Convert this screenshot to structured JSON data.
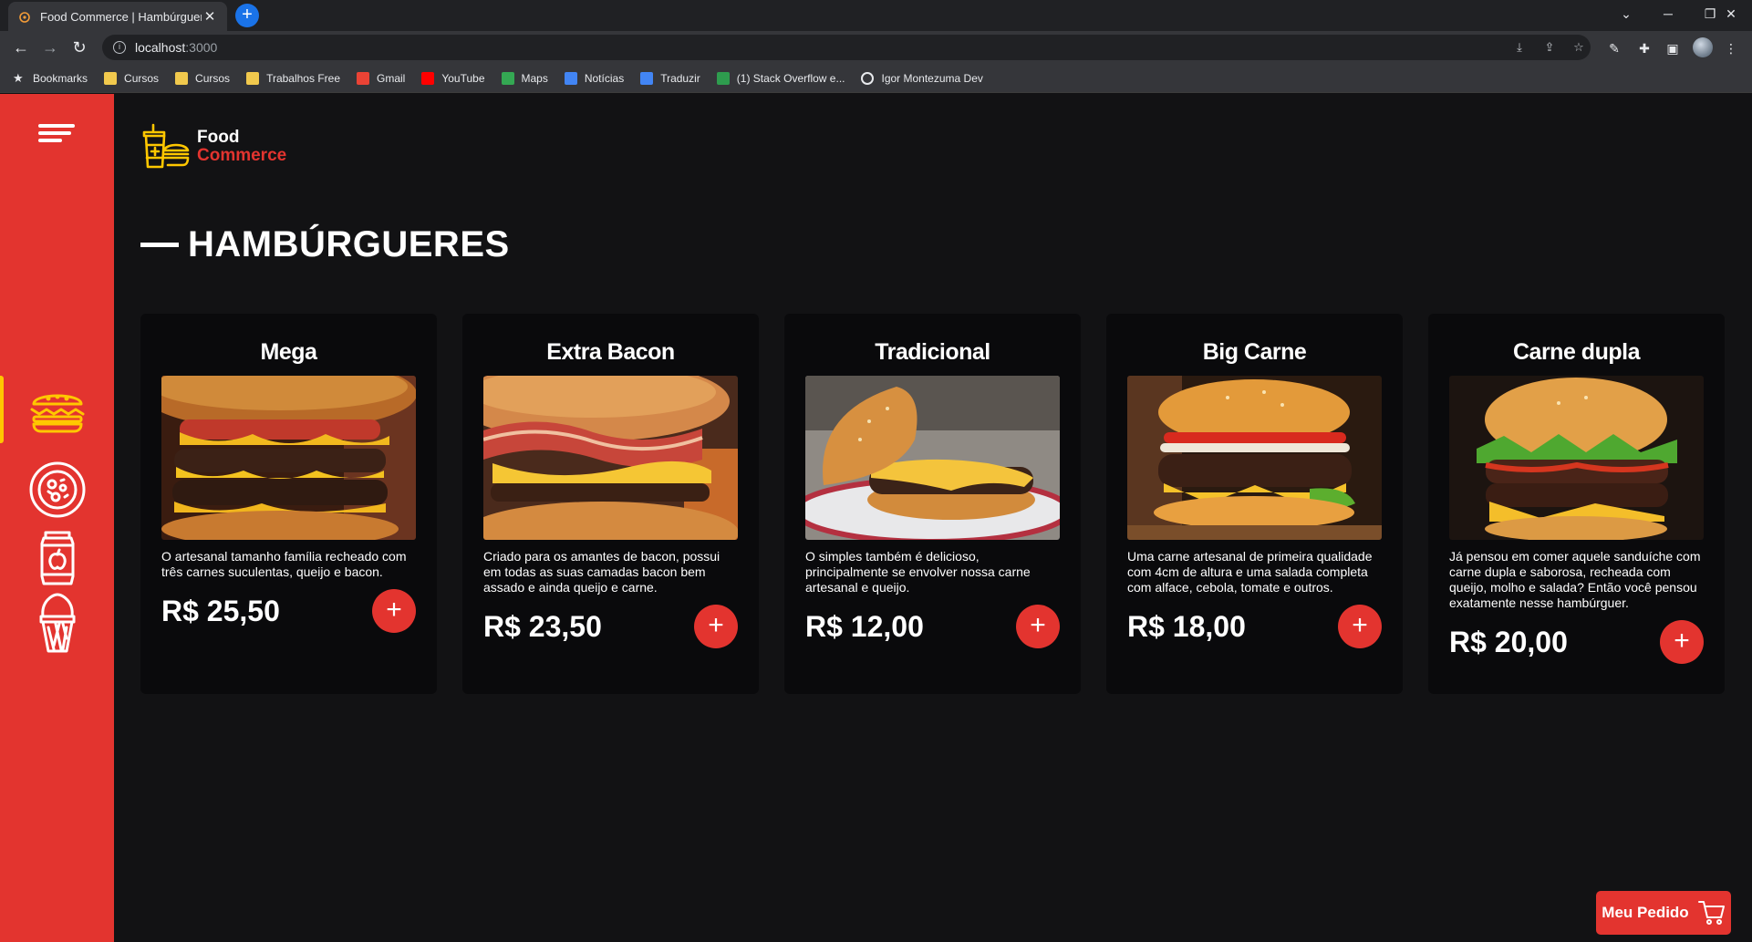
{
  "browser": {
    "tab_title": "Food Commerce | Hambúrgueres",
    "url_host": "localhost",
    "url_port": ":3000",
    "bookmarks": [
      {
        "label": "Bookmarks",
        "icon": "star-icon",
        "color": "#e8eaed"
      },
      {
        "label": "Cursos",
        "icon": "folder-icon",
        "color": "#f1c94d"
      },
      {
        "label": "Cursos",
        "icon": "folder-icon",
        "color": "#f1c94d"
      },
      {
        "label": "Trabalhos Free",
        "icon": "folder-icon",
        "color": "#f1c94d"
      },
      {
        "label": "Gmail",
        "icon": "gmail-icon",
        "color": "#ea4335"
      },
      {
        "label": "YouTube",
        "icon": "youtube-icon",
        "color": "#ff0000"
      },
      {
        "label": "Maps",
        "icon": "maps-icon",
        "color": "#34a853"
      },
      {
        "label": "Notícias",
        "icon": "news-icon",
        "color": "#4285f4"
      },
      {
        "label": "Traduzir",
        "icon": "translate-icon",
        "color": "#4285f4"
      },
      {
        "label": "(1) Stack Overflow e...",
        "icon": "stackoverflow-icon",
        "color": "#2e9c4e"
      },
      {
        "label": "Igor Montezuma Dev",
        "icon": "globe-icon",
        "color": "#e8eaed"
      }
    ]
  },
  "app": {
    "logo": {
      "line1": "Food",
      "line2": "Commerce"
    },
    "section_title": "HAMBÚRGUERES",
    "products": [
      {
        "name": "Mega",
        "description": "O artesanal tamanho família recheado com três carnes suculentas, queijo e bacon.",
        "price": "R$ 25,50"
      },
      {
        "name": "Extra Bacon",
        "description": "Criado para os amantes de bacon, possui em todas as suas camadas bacon bem assado e ainda queijo e carne.",
        "price": "R$ 23,50"
      },
      {
        "name": "Tradicional",
        "description": "O simples também é delicioso, principalmente se envolver nossa carne artesanal e queijo.",
        "price": "R$ 12,00"
      },
      {
        "name": "Big Carne",
        "description": "Uma carne artesanal de primeira qualidade com 4cm de altura e uma salada completa com alface, cebola, tomate e outros.",
        "price": "R$ 18,00"
      },
      {
        "name": "Carne dupla",
        "description": "Já pensou em comer aquele sanduíche com carne dupla e saborosa, recheada com queijo, molho e salada? Então você pensou exatamente nesse hambúrguer.",
        "price": "R$ 20,00"
      }
    ],
    "add_symbol": "+",
    "order_button": "Meu Pedido",
    "colors": {
      "accent": "#e3342f",
      "active_indicator": "#ffc700",
      "background": "#121214",
      "card": "#0a0a0c"
    }
  }
}
